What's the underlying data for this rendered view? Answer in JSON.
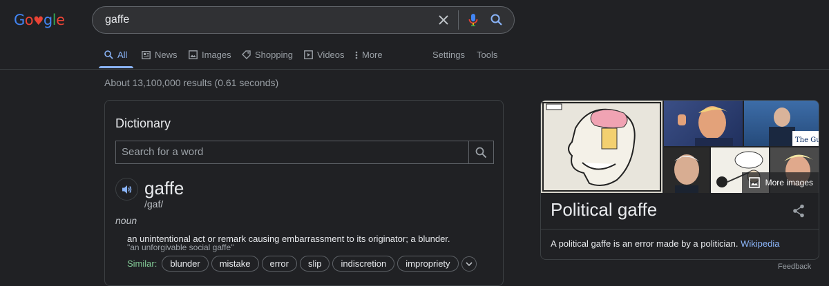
{
  "logo": {
    "text": "Google"
  },
  "search": {
    "query": "gaffe"
  },
  "nav": {
    "all": "All",
    "news": "News",
    "images": "Images",
    "shopping": "Shopping",
    "videos": "Videos",
    "more": "More",
    "settings": "Settings",
    "tools": "Tools"
  },
  "stats": "About 13,100,000 results (0.61 seconds)",
  "dictionary": {
    "title": "Dictionary",
    "search_placeholder": "Search for a word",
    "word": "gaffe",
    "phonetic": "/ɡaf/",
    "part_of_speech": "noun",
    "definition": "an unintentional act or remark causing embarrassment to its originator; a blunder.",
    "example": "\"an unforgivable social gaffe\"",
    "similar_label": "Similar:",
    "similar": [
      "blunder",
      "mistake",
      "error",
      "slip",
      "indiscretion",
      "impropriety"
    ]
  },
  "knowledge_panel": {
    "title": "Political gaffe",
    "description": "A political gaffe is an error made by a politician.",
    "source": "Wikipedia",
    "more_images": "More images"
  },
  "feedback": "Feedback",
  "colors": {
    "accent": "#8ab4f8",
    "background": "#202124",
    "similar": "#81c995"
  }
}
